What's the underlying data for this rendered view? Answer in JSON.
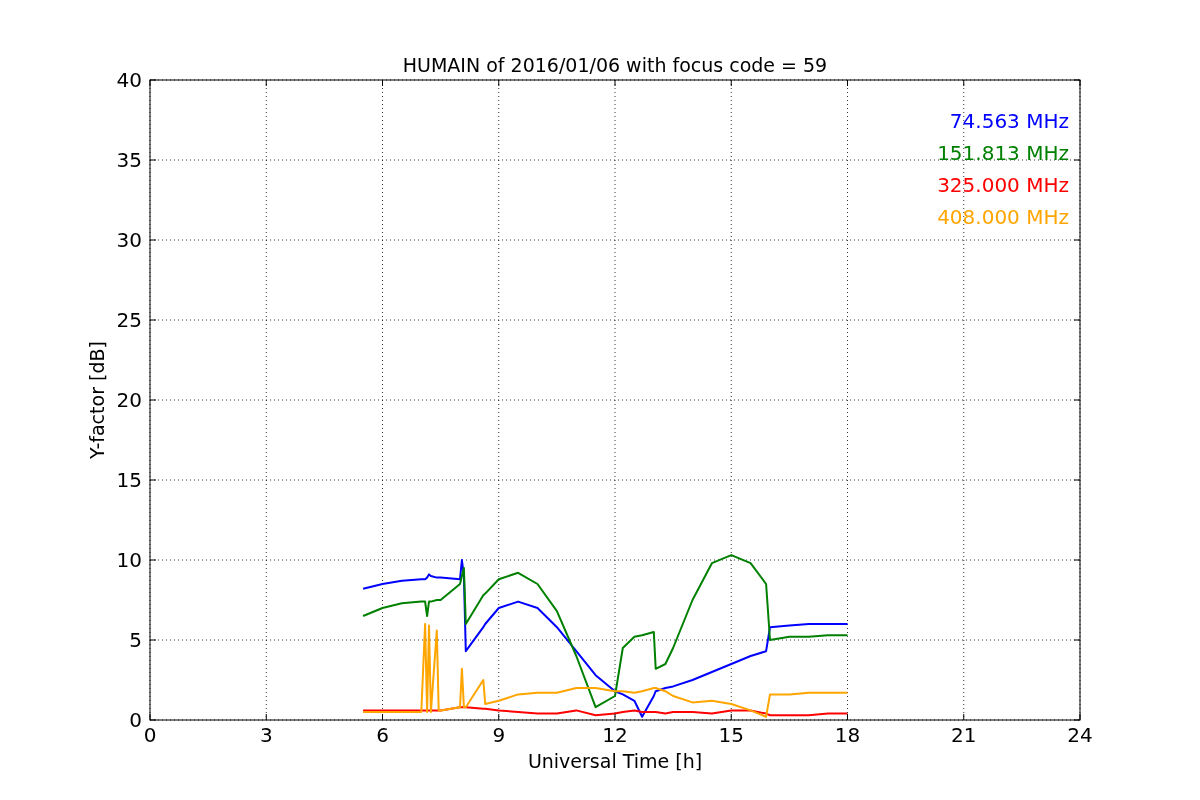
{
  "chart": {
    "chart_data": {
      "type": "line",
      "title": "HUMAIN of 2016/01/06 with focus code = 59",
      "xlabel": "Universal Time [h]",
      "ylabel": "Y-factor [dB]",
      "x": [
        5.5,
        6,
        6.5,
        7,
        7.1,
        7.15,
        7.2,
        7.25,
        7.4,
        7.45,
        7.5,
        8,
        8.05,
        8.1,
        8.15,
        8.6,
        8.65,
        9,
        9.5,
        10,
        10.5,
        11,
        11.5,
        12,
        12.2,
        12.5,
        12.7,
        13,
        13.05,
        13.3,
        13.5,
        14,
        14.5,
        15,
        15.5,
        15.9,
        16,
        16.5,
        17,
        17.5,
        18
      ],
      "series": [
        {
          "name": "74.563 MHz",
          "color": "#0000ff",
          "values": [
            8.2,
            8.5,
            8.7,
            8.8,
            8.8,
            8.9,
            9.1,
            9.0,
            8.9,
            8.9,
            8.9,
            8.8,
            10,
            9,
            4.3,
            5.8,
            6,
            7.0,
            7.4,
            7.0,
            5.8,
            4.3,
            2.8,
            1.8,
            1.6,
            1.2,
            0.2,
            1.5,
            1.8,
            2.0,
            2.1,
            2.5,
            3.0,
            3.5,
            4.0,
            4.3,
            5.8,
            5.9,
            6.0,
            6.0,
            6.0
          ]
        },
        {
          "name": "151.813 MHz",
          "color": "#008000",
          "values": [
            6.5,
            7.0,
            7.3,
            7.4,
            7.4,
            6.5,
            7.4,
            7.4,
            7.5,
            7.5,
            7.5,
            8.5,
            9.0,
            9.5,
            6.0,
            7.8,
            7.9,
            8.8,
            9.2,
            8.5,
            6.8,
            4.0,
            0.8,
            1.5,
            4.5,
            5.2,
            5.3,
            5.5,
            3.2,
            3.5,
            4.5,
            7.5,
            9.8,
            10.3,
            9.8,
            8.5,
            5.0,
            5.2,
            5.2,
            5.3,
            5.3
          ]
        },
        {
          "name": "325.000 MHz",
          "color": "#ff0000",
          "values": [
            0.6,
            0.6,
            0.6,
            0.6,
            0.6,
            0.6,
            0.6,
            0.6,
            0.6,
            0.6,
            0.6,
            0.8,
            0.8,
            0.8,
            0.8,
            0.7,
            0.7,
            0.6,
            0.5,
            0.4,
            0.4,
            0.6,
            0.3,
            0.4,
            0.5,
            0.6,
            0.5,
            0.5,
            0.5,
            0.4,
            0.5,
            0.5,
            0.4,
            0.6,
            0.6,
            0.4,
            0.3,
            0.3,
            0.3,
            0.4,
            0.4
          ]
        },
        {
          "name": "408.000 MHz",
          "color": "#ffa500",
          "values": [
            0.5,
            0.5,
            0.5,
            0.5,
            6.0,
            0.5,
            5.9,
            0.5,
            5.6,
            0.6,
            0.6,
            0.8,
            3.2,
            0.8,
            0.8,
            2.5,
            1.0,
            1.2,
            1.6,
            1.7,
            1.7,
            2.0,
            2.0,
            1.8,
            1.8,
            1.7,
            1.8,
            2.0,
            2.0,
            1.8,
            1.5,
            1.1,
            1.2,
            1.0,
            0.6,
            0.2,
            1.6,
            1.6,
            1.7,
            1.7,
            1.7
          ]
        }
      ],
      "xlim": [
        0,
        24
      ],
      "ylim": [
        0,
        40
      ],
      "xticks": [
        0,
        3,
        6,
        9,
        12,
        15,
        18,
        21,
        24
      ],
      "yticks": [
        0,
        5,
        10,
        15,
        20,
        25,
        30,
        35,
        40
      ],
      "grid": true
    }
  }
}
